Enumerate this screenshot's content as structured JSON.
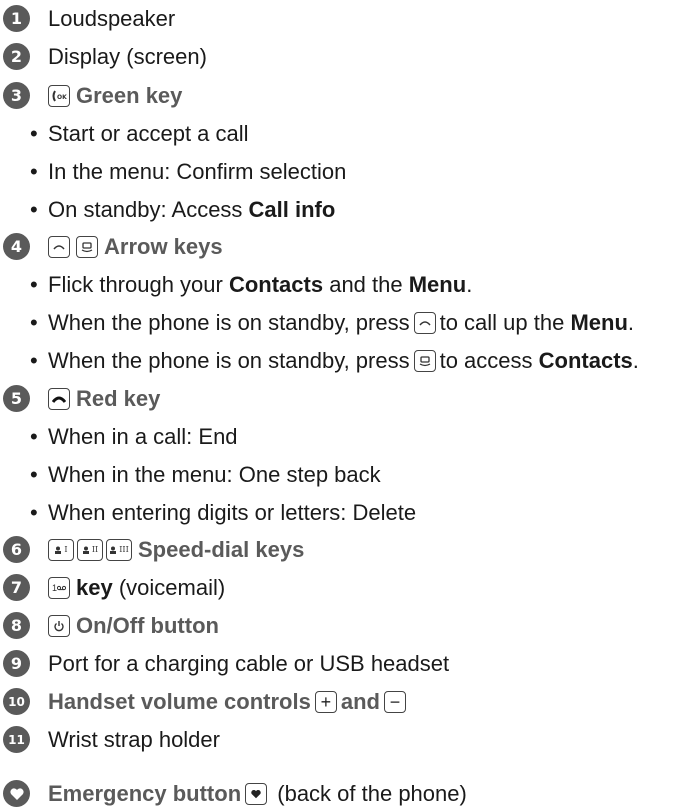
{
  "items": [
    {
      "num": "1",
      "label": "Loudspeaker"
    },
    {
      "num": "2",
      "label": "Display (screen)"
    },
    {
      "num": "3",
      "key_glyph": "(OK",
      "label": "Green key",
      "bullets": [
        {
          "pre": "Start or accept a call"
        },
        {
          "pre": "In the menu: Confirm selection"
        },
        {
          "pre": "On standby: Access ",
          "bold": "Call info"
        }
      ]
    },
    {
      "num": "4",
      "label": "Arrow keys",
      "bullets": [
        {
          "pre": "Flick through your ",
          "bold": "Contacts",
          "mid": " and the ",
          "bold2": "Menu",
          "post": "."
        },
        {
          "pre": "When the phone is on standby, press",
          "post": "to call up the ",
          "bold": "Menu",
          "end": "."
        },
        {
          "pre": "When the phone is on standby, press",
          "post": "to access ",
          "bold": "Contacts",
          "end": "."
        }
      ]
    },
    {
      "num": "5",
      "label": "Red key",
      "bullets": [
        {
          "pre": "When in a call: End"
        },
        {
          "pre": "When in the menu: One step back"
        },
        {
          "pre": "When entering digits or letters: Delete"
        }
      ]
    },
    {
      "num": "6",
      "label": "Speed-dial keys",
      "speed_keys": [
        "I",
        "II",
        "III"
      ]
    },
    {
      "num": "7",
      "key_glyph": "1",
      "label": "key",
      "suffix": " (voicemail)"
    },
    {
      "num": "8",
      "label": "On/Off button"
    },
    {
      "num": "9",
      "label": "Port for a charging cable or USB headset"
    },
    {
      "num": "10",
      "label": "Handset volume controls",
      "and": "and",
      "plus": "+",
      "minus": "−"
    },
    {
      "num": "11",
      "label": "Wrist strap holder"
    }
  ],
  "emergency": {
    "label": "Emergency button",
    "suffix": " (back of the phone)"
  },
  "colors": {
    "badge": "#5a5a5a",
    "heading": "#5a5a5a",
    "text": "#1a1a1a"
  },
  "icons": {
    "green_key": "phone-ok-icon",
    "arrow_up": "arrow-up-key-icon",
    "arrow_contacts": "contacts-key-icon",
    "red_key": "hang-up-icon",
    "speed_dial": "speed-dial-key-icon",
    "voicemail": "voicemail-key-icon",
    "power": "power-icon",
    "plus": "plus-key-icon",
    "minus": "minus-key-icon",
    "heart": "heart-icon"
  }
}
